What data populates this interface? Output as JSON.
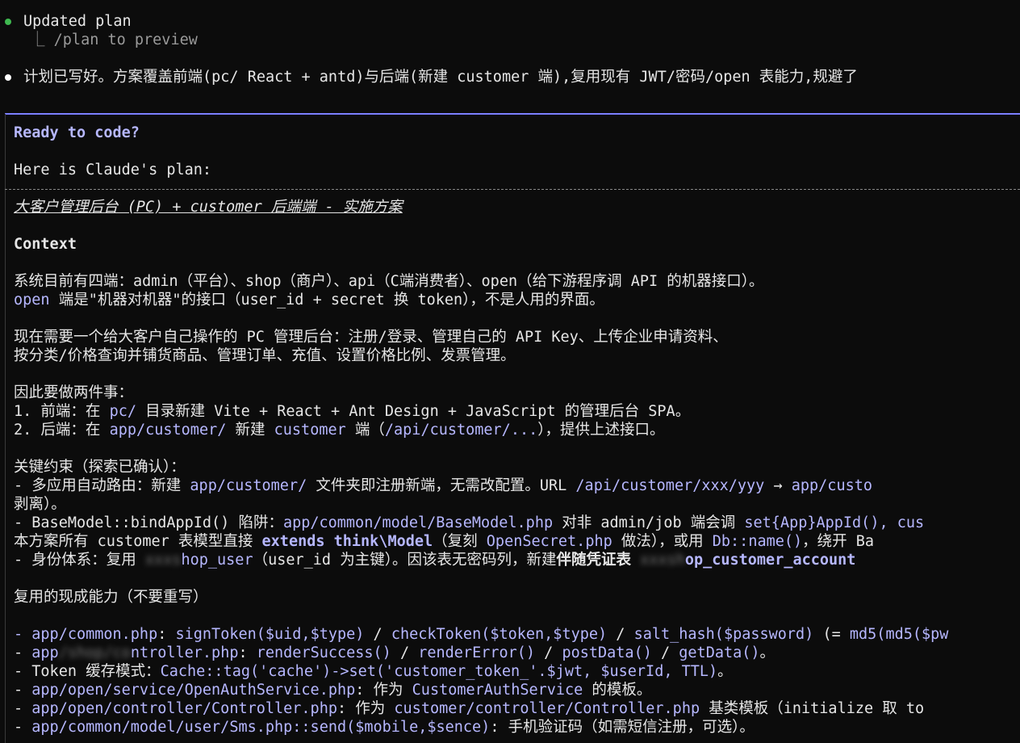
{
  "header": {
    "status_dot_color": "#3fb950",
    "title": "Updated plan",
    "subtitle_branch": "⎿",
    "subtitle": "/plan to preview"
  },
  "message": {
    "bullet_color": "#ffffff",
    "text": "计划已写好。方案覆盖前端(pc/ React + antd)与后端(新建 customer 端),复用现有 JWT/密码/open 表能力,规避了"
  },
  "prompt": {
    "accent_color": "#7b7fff",
    "title": "Ready to code?",
    "intro": "Here is Claude's plan:"
  },
  "plan": {
    "title": "大客户管理后台 (PC) + customer 后端端 - 实施方案",
    "context_heading": "Context",
    "p1_a": "系统目前有四端：admin（平台）、shop（商户）、api（C端消费者）、open（给下游程序调 API 的机器接口）。",
    "p1_b_code": "open",
    "p1_b_rest": " 端是\"机器对机器\"的接口（user_id + secret 换 token），不是人用的界面。",
    "p2_a": "现在需要一个给大客户自己操作的 PC 管理后台：注册/登录、管理自己的 API Key、上传企业申请资料、",
    "p2_b": "按分类/价格查询并铺货商品、管理订单、充值、设置价格比例、发票管理。",
    "p3_intro": "因此要做两件事：",
    "p3_1_a": "1. 前端：在 ",
    "p3_1_code": "pc/",
    "p3_1_b": " 目录新建 Vite + React + Ant Design + JavaScript 的管理后台 SPA。",
    "p3_2_a": "2. 后端：在 ",
    "p3_2_code1": "app/customer/",
    "p3_2_b": " 新建 ",
    "p3_2_code2": "customer",
    "p3_2_c": " 端（",
    "p3_2_code3": "/api/customer/...",
    "p3_2_d": "），提供上述接口。",
    "constraints_heading": "关键约束（探索已确认）：",
    "c1_a": "- 多应用自动路由：新建 ",
    "c1_code1": "app/customer/",
    "c1_b": " 文件夹即注册新端，无需改配置。URL ",
    "c1_code2": "/api/customer/xxx/yyy",
    "c1_c": " → ",
    "c1_code3": "app/custo",
    "c1_wrap": "剥离）。",
    "c2_a": "- BaseModel::bindAppId() 陷阱：",
    "c2_code1": "app/common/model/BaseModel.php",
    "c2_b": " 对非 admin/job 端会调 ",
    "c2_code2": "set{App}AppId(), cus",
    "c2_wrap_a": "本方案所有 customer 表模型直接 ",
    "c2_wrap_kw": "extends think\\Model",
    "c2_wrap_b": "（复刻 ",
    "c2_wrap_code1": "OpenSecret.php",
    "c2_wrap_c": " 做法），或用 ",
    "c2_wrap_code2": "Db::name()",
    "c2_wrap_d": "，绕开 Ba",
    "c3_a": "- 身份体系：复用 ",
    "c3_blur1": "xxxs",
    "c3_code1": "hop_user",
    "c3_b": "（user_id 为主键）。因该表无密码列，新建",
    "c3_bold": "伴随凭证表",
    "c3_c": " ",
    "c3_blur2": "xxxsh",
    "c3_code2": "op_customer_account",
    "reuse_heading": "复用的现成能力（不要重写）",
    "r1_code1": "- app/common.php",
    "r1_a": ": ",
    "r1_code2": "signToken($uid,$type)",
    "r1_b": " / ",
    "r1_code3": "checkToken($token,$type)",
    "r1_c": " / ",
    "r1_code4": "salt_hash($password)",
    "r1_d": " (= ",
    "r1_code5": "md5(md5($pw",
    "r2_dash": "- ",
    "r2_code1a": "app",
    "r2_blur": "/shop/co",
    "r2_code1b": "ntroller.php",
    "r2_a": ": ",
    "r2_code2": "renderSuccess()",
    "r2_b": " / ",
    "r2_code3": "renderError()",
    "r2_c": " / ",
    "r2_code4": "postData()",
    "r2_d": " / ",
    "r2_code5": "getData()",
    "r2_e": "。",
    "r3_a": "- Token 缓存模式：",
    "r3_code": "Cache::tag('cache')->set('customer_token_'.$jwt, $userId, TTL)",
    "r3_b": "。",
    "r4_dash": "- ",
    "r4_code1": "app/open/service/OpenAuthService.php",
    "r4_a": ": 作为 ",
    "r4_code2": "CustomerAuthService",
    "r4_b": " 的模板。",
    "r5_dash": "- ",
    "r5_code1": "app/open/controller/Controller.php",
    "r5_a": ": 作为 ",
    "r5_code2": "customer/controller/Controller.php",
    "r5_b": " 基类模板（initialize 取 to",
    "r6_dash": "- ",
    "r6_code1": "app/common/model/user/Sms.php::send($mobile,$sence)",
    "r6_a": ": 手机验证码（如需短信注册，可选）。"
  }
}
